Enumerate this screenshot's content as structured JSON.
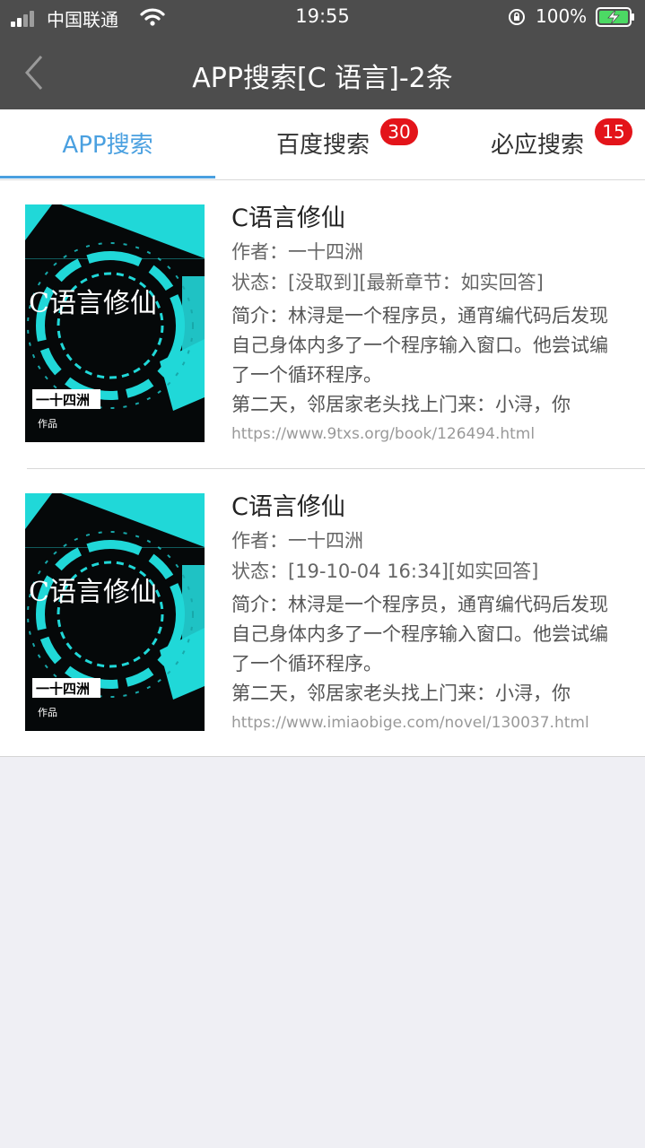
{
  "status_bar": {
    "carrier": "中国联通",
    "time": "19:55",
    "battery_percent": "100%",
    "icons": [
      "signal-icon",
      "wifi-icon",
      "orientation-lock-icon",
      "battery-charging-icon"
    ]
  },
  "nav": {
    "back_icon": "chevron-left-icon",
    "title": "APP搜索[C 语言]-2条"
  },
  "tabs": [
    {
      "label": "APP搜索",
      "badge": "",
      "active": true
    },
    {
      "label": "百度搜索",
      "badge": "30",
      "active": false
    },
    {
      "label": "必应搜索",
      "badge": "15",
      "active": false
    }
  ],
  "colors": {
    "header_bg": "#4d4d4d",
    "accent": "#4aa0e0",
    "badge": "#e3141a",
    "cover_cyan": "#20d8d8"
  },
  "results": [
    {
      "title": "C语言修仙",
      "author": "作者：一十四洲",
      "status": "状态：[没取到][最新章节：如实回答]",
      "intro": "简介：林浔是一个程序员，通宵编代码后发现自己身体内多了一个程序输入窗口。他尝试编了一个循环程序。\n第二天，邻居家老头找上门来：小浔，你",
      "url": "https://www.9txs.org/book/126494.html",
      "cover": {
        "title_text": "C语言修仙",
        "author_text": "一十四洲",
        "works_text": "作品"
      }
    },
    {
      "title": "C语言修仙",
      "author": "作者：一十四洲",
      "status": "状态：[19-10-04 16:34][如实回答]",
      "intro": "简介：林浔是一个程序员，通宵编代码后发现自己身体内多了一个程序输入窗口。他尝试编了一个循环程序。\n第二天，邻居家老头找上门来：小浔，你",
      "url": "https://www.imiaobige.com/novel/130037.html",
      "cover": {
        "title_text": "C语言修仙",
        "author_text": "一十四洲",
        "works_text": "作品"
      }
    }
  ]
}
